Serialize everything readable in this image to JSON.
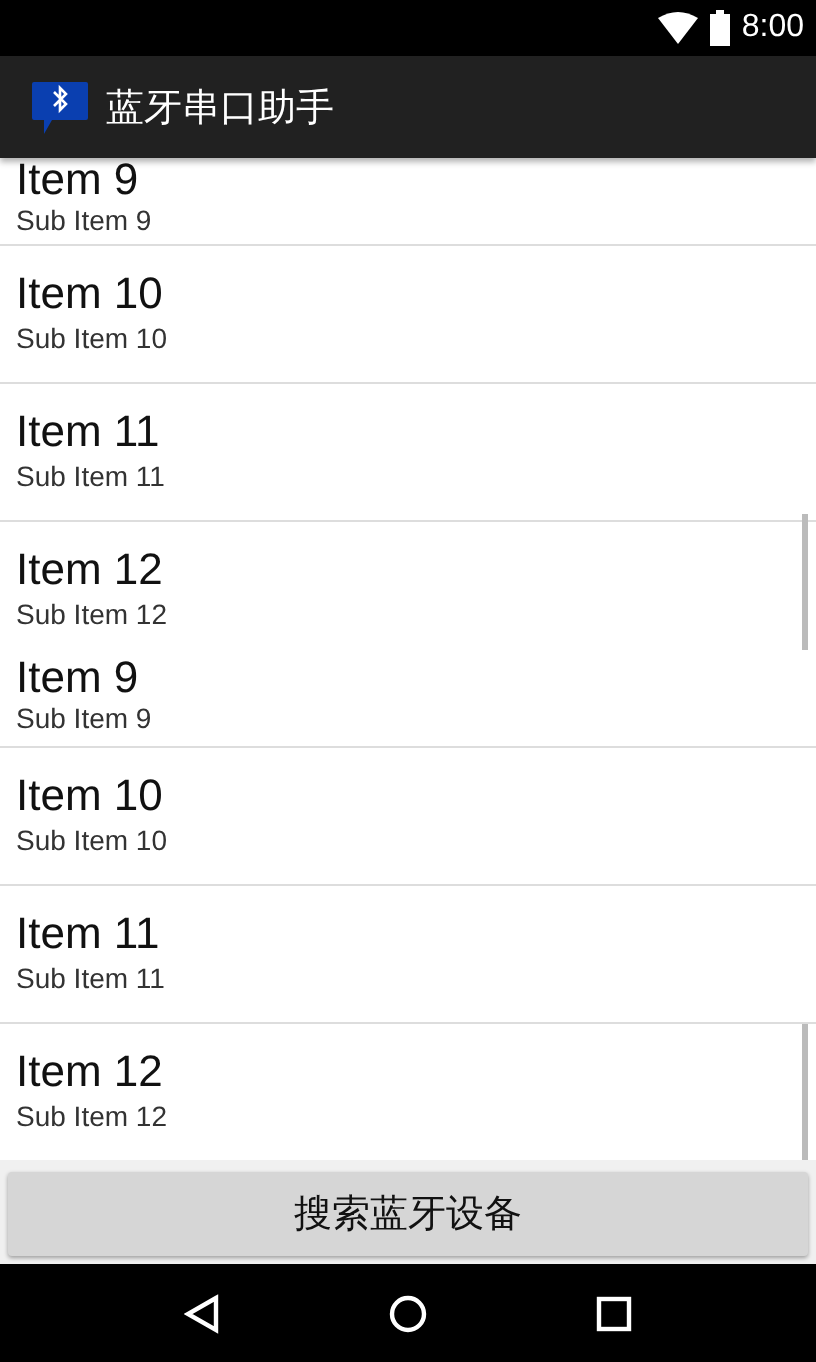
{
  "status_bar": {
    "time": "8:00"
  },
  "app_bar": {
    "title": "蓝牙串口助手"
  },
  "lists": [
    {
      "items": [
        {
          "title": "Item 9",
          "subtitle": "Sub Item 9"
        },
        {
          "title": "Item 10",
          "subtitle": "Sub Item 10"
        },
        {
          "title": "Item 11",
          "subtitle": "Sub Item 11"
        },
        {
          "title": "Item 12",
          "subtitle": "Sub Item 12"
        }
      ]
    },
    {
      "items": [
        {
          "title": "Item 9",
          "subtitle": "Sub Item 9"
        },
        {
          "title": "Item 10",
          "subtitle": "Sub Item 10"
        },
        {
          "title": "Item 11",
          "subtitle": "Sub Item 11"
        },
        {
          "title": "Item 12",
          "subtitle": "Sub Item 12"
        }
      ]
    }
  ],
  "button": {
    "label": "搜索蓝牙设备"
  }
}
